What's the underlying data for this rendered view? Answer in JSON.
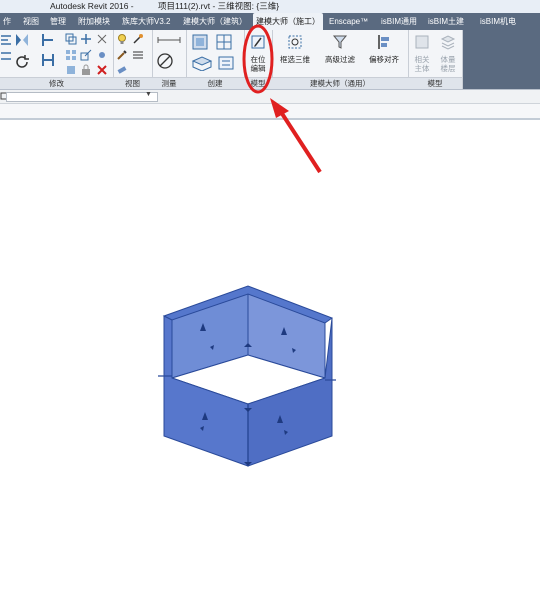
{
  "title": {
    "app": "Autodesk Revit 2016 -",
    "document": "项目111(2).rvt - 三维视图: {三维}"
  },
  "tabs": [
    "作",
    "视图",
    "管理",
    "附加模块",
    "族库大师V3.2",
    "建模大师（建筑）",
    "建模大师（施工）",
    "Enscape™",
    "isBIM通用",
    "isBIM土建",
    "isBIM机电"
  ],
  "ribbon": {
    "panels": {
      "modify": "修改",
      "view": "视图",
      "measure": "测量",
      "create": "创建",
      "model": "模型",
      "jianmo_general": "建模大师（通用）",
      "model2": "模型"
    },
    "buttons": {
      "inplace_edit": "在位\n编辑",
      "box_select_3d": "框选三维",
      "advanced_filter": "高级过滤",
      "offset_align": "偏移对齐",
      "related_host": "相关\n主体",
      "volume_area": "体量\n楼层"
    }
  },
  "annotation": {
    "highlight_color": "#e02020",
    "target": "在位编辑"
  },
  "model_view": {
    "object": "hexagonal wall frame",
    "fill_color": "#4a6ec8",
    "edge_color": "#2a4a9a"
  }
}
